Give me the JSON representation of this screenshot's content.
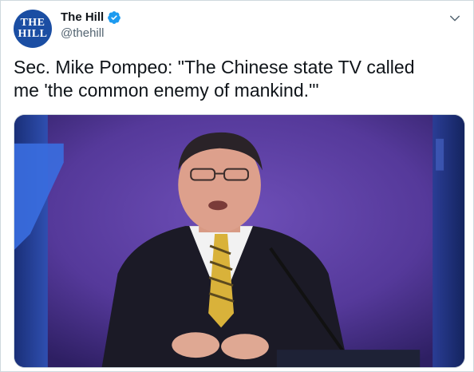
{
  "tweet": {
    "avatar": {
      "line1": "THE",
      "line2": "HILL",
      "color": "#1b4ea3"
    },
    "author": {
      "display_name": "The Hill",
      "handle": "@thehill",
      "verified": true
    },
    "menu_icon": "chevron-down-icon",
    "text": "Sec. Mike Pompeo: \"The Chinese state TV called\nme 'the common enemy of mankind.'\"",
    "media": {
      "type": "video",
      "background_color": "#5b3d9e"
    }
  }
}
